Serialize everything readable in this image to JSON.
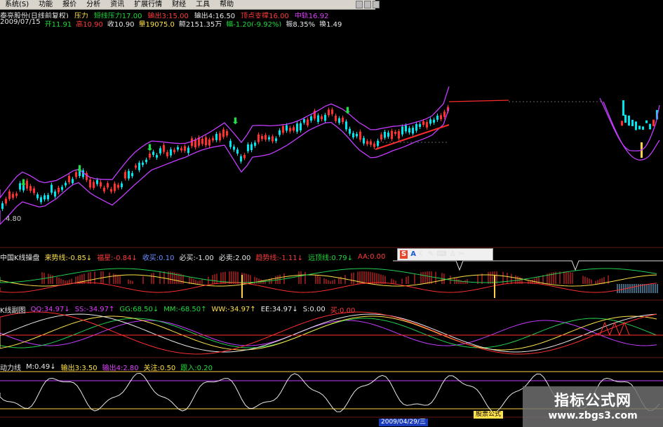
{
  "menubar": {
    "items": [
      "系统(S)",
      "功能",
      "报价",
      "分析",
      "资讯",
      "扩展行情",
      "财经",
      "工具",
      "帮助"
    ]
  },
  "info_row1": [
    {
      "t": "泰亮股份(日线前复权)",
      "c": "w"
    },
    {
      "t": "压力",
      "c": "y"
    },
    {
      "t": "短线压力17.00",
      "c": "g"
    },
    {
      "t": "输出3:15.00",
      "c": "r"
    },
    {
      "t": "输出4:16.50",
      "c": "w"
    },
    {
      "t": "顶点支撑16.00",
      "c": "r"
    },
    {
      "t": "中轨16.92",
      "c": "m"
    }
  ],
  "info_row2": [
    {
      "t": "2009/07/15",
      "c": "w"
    },
    {
      "t": "开11.91",
      "c": "g"
    },
    {
      "t": "高10.90",
      "c": "r"
    },
    {
      "t": "收10.90",
      "c": "w"
    },
    {
      "t": "量19075.0",
      "c": "y"
    },
    {
      "t": "额2151.35万",
      "c": "w"
    },
    {
      "t": "幅-1.20(-9.92%)",
      "c": "g"
    },
    {
      "t": "振8.35%",
      "c": "w"
    },
    {
      "t": "换1.49",
      "c": "w"
    }
  ],
  "price_low": "4.80",
  "indicator1": [
    {
      "t": "中国K线操盘",
      "c": "w"
    },
    {
      "t": "来势线:-0.85↓",
      "c": "y"
    },
    {
      "t": "福星:-0.84↓",
      "c": "r"
    },
    {
      "t": "收买:0.10",
      "c": "b"
    },
    {
      "t": "必买:-1.00",
      "c": "w"
    },
    {
      "t": "必卖:2.00",
      "c": "w"
    },
    {
      "t": "趋势线:-1.11↓",
      "c": "r"
    },
    {
      "t": "远顶线:0.79↓",
      "c": "g"
    },
    {
      "t": "AA:0.00",
      "c": "r"
    }
  ],
  "indicator2": [
    {
      "t": "K线副图",
      "c": "w"
    },
    {
      "t": "QQ:34.97↓",
      "c": "m"
    },
    {
      "t": "SS:-34.97↑",
      "c": "m"
    },
    {
      "t": "GG:68.50↓",
      "c": "g"
    },
    {
      "t": "MM:-68.50↑",
      "c": "g"
    },
    {
      "t": "WW:-34.97↑",
      "c": "y"
    },
    {
      "t": "EE:34.97↓",
      "c": "w"
    },
    {
      "t": "S:0.00",
      "c": "w"
    },
    {
      "t": "买:0.00",
      "c": "r"
    }
  ],
  "indicator3": [
    {
      "t": "动力线",
      "c": "w"
    },
    {
      "t": "M:0.49↓",
      "c": "w"
    },
    {
      "t": "输出3:3.50",
      "c": "y"
    },
    {
      "t": "输出4:2.80",
      "c": "m"
    },
    {
      "t": "关注:0.50",
      "c": "y"
    },
    {
      "t": "跟入:0.20",
      "c": "g"
    }
  ],
  "date_label": "2009/04/29/三",
  "stamp_label": "股票公式",
  "watermark": {
    "title": "指标公式网",
    "url": "www.zbgs3.com"
  },
  "colors": {
    "up": "#ff3030",
    "down": "#00e5ee",
    "upper_band": "#c43cff",
    "trend": "#ff2a2a"
  }
}
